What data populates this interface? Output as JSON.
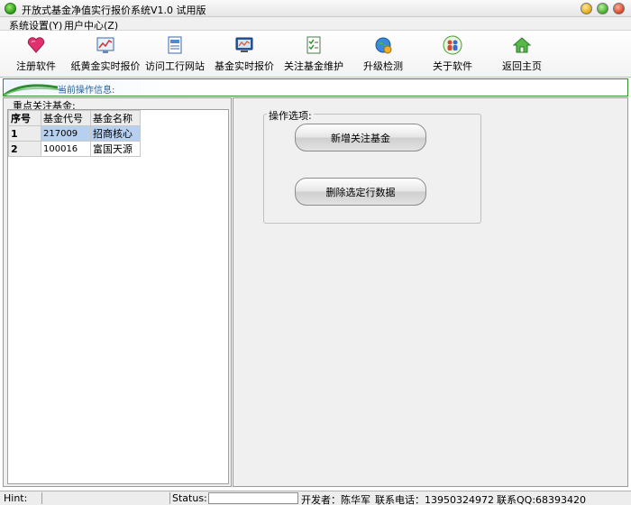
{
  "window": {
    "title": "开放式基金净值实行报价系统V1.0  试用版"
  },
  "menu": {
    "items": [
      "系统设置(Y)",
      "用户中心(Z)"
    ]
  },
  "toolbar": {
    "items": [
      {
        "label": "注册软件",
        "icon": "heart-icon"
      },
      {
        "label": "纸黄金实时报价",
        "icon": "chart-icon"
      },
      {
        "label": "访问工行网站",
        "icon": "document-icon"
      },
      {
        "label": "基金实时报价",
        "icon": "monitor-chart-icon"
      },
      {
        "label": "关注基金维护",
        "icon": "checklist-icon"
      },
      {
        "label": "升级检测",
        "icon": "globe-update-icon"
      },
      {
        "label": "关于软件",
        "icon": "people-icon"
      },
      {
        "label": "返回主页",
        "icon": "home-icon"
      }
    ]
  },
  "infobar": {
    "label": "当前操作信息:"
  },
  "left": {
    "group_title": "重点关注基金:",
    "columns": [
      "序号",
      "基金代号",
      "基金名称"
    ],
    "rows": [
      {
        "no": "1",
        "code": "217009",
        "name": "招商核心"
      },
      {
        "no": "2",
        "code": "100016",
        "name": "富国天源"
      }
    ]
  },
  "right": {
    "group_title": "操作选项:",
    "add_button": "新增关注基金",
    "delete_button": "删除选定行数据"
  },
  "status": {
    "hint_label": "Hint:",
    "status_label": "Status:",
    "developer": "开发者：陈华军",
    "phone": "联系电话：13950324972",
    "qq": "联系QQ:68393420"
  },
  "colors": {
    "accent_green": "#2f8f2f",
    "selection": "#b8d0f0"
  }
}
